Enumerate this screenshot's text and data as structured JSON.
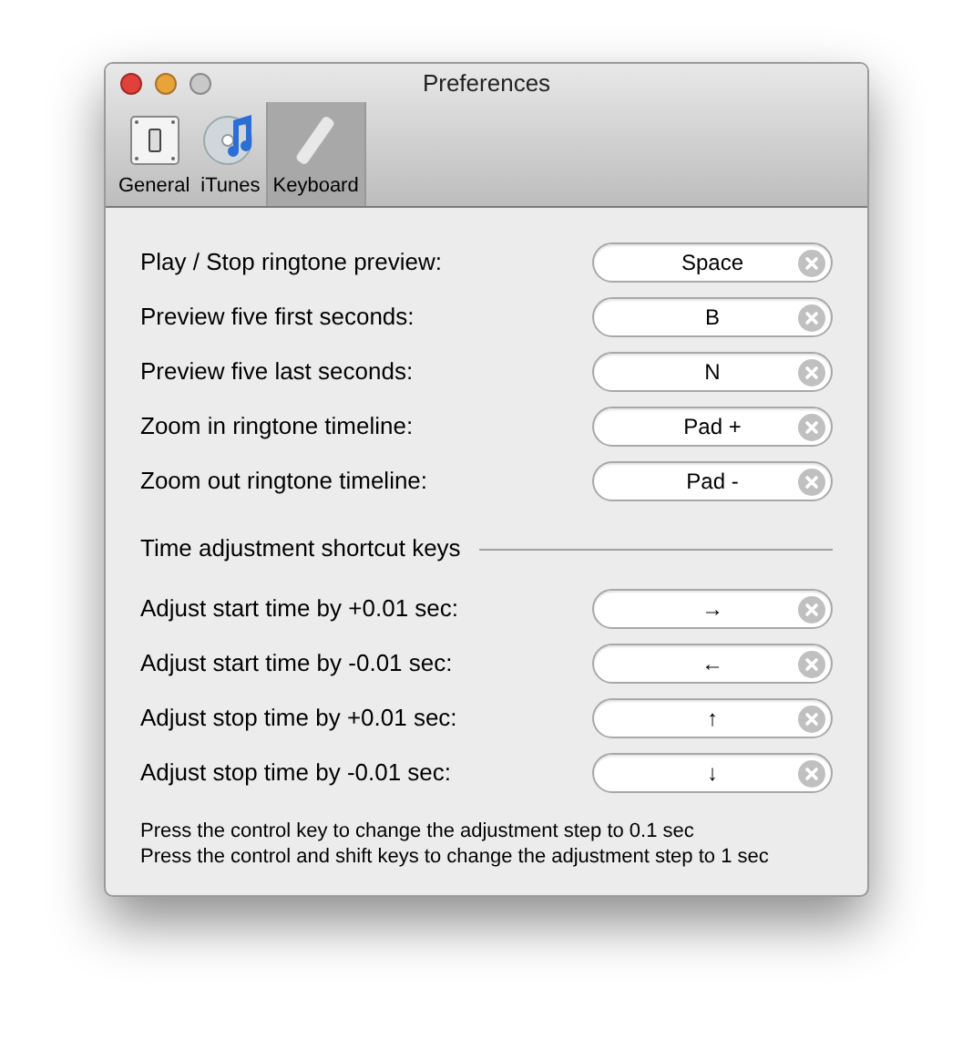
{
  "window": {
    "title": "Preferences"
  },
  "tabs": [
    {
      "label": "General",
      "selected": false,
      "kind": "switch"
    },
    {
      "label": "iTunes",
      "selected": false,
      "kind": "disc"
    },
    {
      "label": "Keyboard",
      "selected": true,
      "kind": "remote"
    }
  ],
  "shortcuts": [
    {
      "label": "Play / Stop ringtone preview:",
      "key": "Space"
    },
    {
      "label": "Preview five first seconds:",
      "key": "B"
    },
    {
      "label": "Preview five last seconds:",
      "key": "N"
    },
    {
      "label": "Zoom in ringtone timeline:",
      "key": "Pad +"
    },
    {
      "label": "Zoom out ringtone timeline:",
      "key": "Pad -"
    }
  ],
  "section_title": "Time adjustment shortcut keys",
  "adjustments": [
    {
      "label": "Adjust start time by +0.01 sec:",
      "key": "→"
    },
    {
      "label": "Adjust start time by -0.01 sec:",
      "key": "←"
    },
    {
      "label": "Adjust stop time by +0.01 sec:",
      "key": "↑"
    },
    {
      "label": "Adjust stop time by -0.01 sec:",
      "key": "↓"
    }
  ],
  "notes": [
    "Press the control key to change the adjustment step to 0.1 sec",
    "Press the control and shift keys to change the adjustment step to 1 sec"
  ]
}
